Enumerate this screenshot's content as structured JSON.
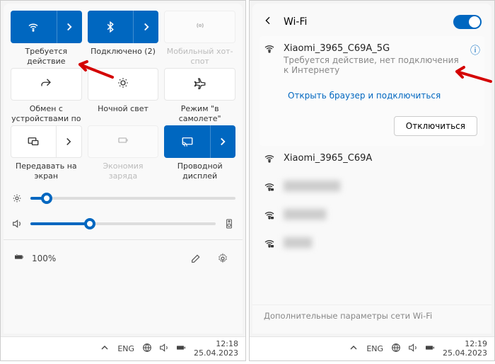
{
  "left": {
    "tiles": {
      "wifi_label": "Требуется действие",
      "bt_label": "Подключено (2)",
      "hotspot_label": "Мобильный хот-спот",
      "share_label": "Обмен с устройствами по",
      "nightlight_label": "Ночной свет",
      "airplane_label": "Режим \"в самолете\"",
      "project_label": "Передавать на экран",
      "battery_saver_label": "Экономия заряда",
      "cast_label": "Проводной дисплей"
    },
    "brightness_pct": 8,
    "volume_pct": 32,
    "battery_text": "100%"
  },
  "right": {
    "title": "Wi-Fi",
    "current": {
      "name": "Xiaomi_3965_C69A_5G",
      "status": "Требуется действие, нет подключения к Интернету",
      "link": "Открыть браузер и подключиться",
      "disconnect": "Отключиться"
    },
    "other": [
      {
        "name": "Xiaomi_3965_C69A",
        "locked": false
      },
      {
        "name": "hidden1",
        "locked": true
      },
      {
        "name": "hidden2",
        "locked": true
      },
      {
        "name": "hidden3",
        "locked": true
      }
    ],
    "footer": "Дополнительные параметры сети Wi-Fi"
  },
  "taskbar": {
    "lang": "ENG",
    "left_time": "12:18",
    "left_date": "25.04.2023",
    "right_time": "12:19",
    "right_date": "25.04.2023"
  }
}
